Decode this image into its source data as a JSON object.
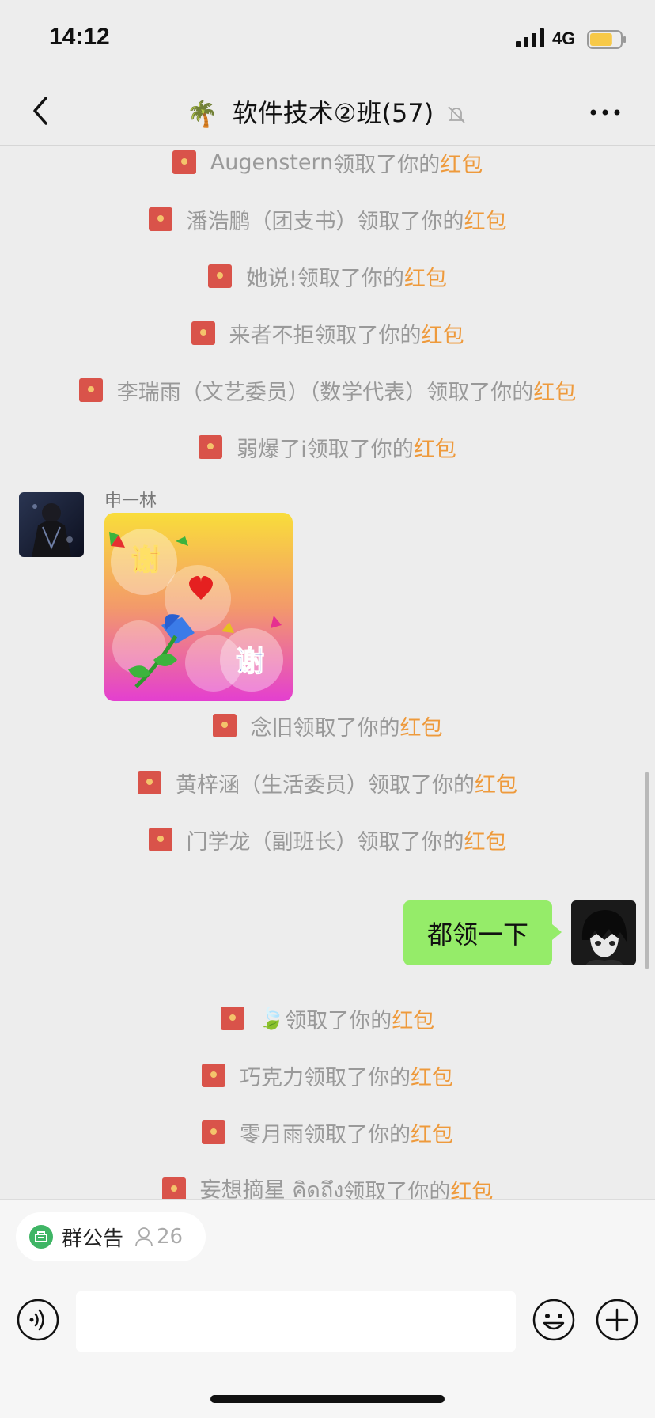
{
  "status_bar": {
    "time": "14:12",
    "network": "4G",
    "battery_level": 0.75,
    "battery_color": "#f7c948"
  },
  "nav": {
    "back_icon": "chevron-left-icon",
    "title_emoji": "🌴",
    "title": "软件技术②班(57)",
    "mute_icon": "bell-slash-icon",
    "more_icon": "more-dots-icon"
  },
  "chat": {
    "redpacket_suffix": "领取了你的",
    "redpacket_link": "红包",
    "claims_top": [
      {
        "name": "Augenstern"
      },
      {
        "name": "潘浩鹏（团支书）"
      },
      {
        "name": "她说!"
      },
      {
        "name": "来者不拒"
      },
      {
        "name": "李瑞雨（文艺委员）（数学代表）"
      },
      {
        "name": "弱爆了i"
      }
    ],
    "sticker_message": {
      "sender": "申一林",
      "sticker_text_top": "谢",
      "sticker_text_bottom": "谢"
    },
    "claims_middle": [
      {
        "name": "念旧"
      },
      {
        "name": "黄梓涵（生活委员）"
      },
      {
        "name": "门学龙（副班长）"
      }
    ],
    "my_message": {
      "text": "都领一下"
    },
    "claims_bottom": [
      {
        "name": "🍃 "
      },
      {
        "name": "巧克力"
      },
      {
        "name": "零月雨"
      },
      {
        "name": "妄想摘星 คิดถึง "
      }
    ]
  },
  "bottom": {
    "notice_label": "群公告",
    "notice_count": "26",
    "notice_icon": "announcement-icon",
    "person_icon": "person-icon",
    "voice_icon": "voice-icon",
    "input_placeholder": "",
    "emoji_icon": "emoji-icon",
    "plus_icon": "plus-circle-icon"
  },
  "colors": {
    "redpacket_link": "#ee9a3c",
    "my_bubble": "#95ec69",
    "background": "#ededed"
  }
}
